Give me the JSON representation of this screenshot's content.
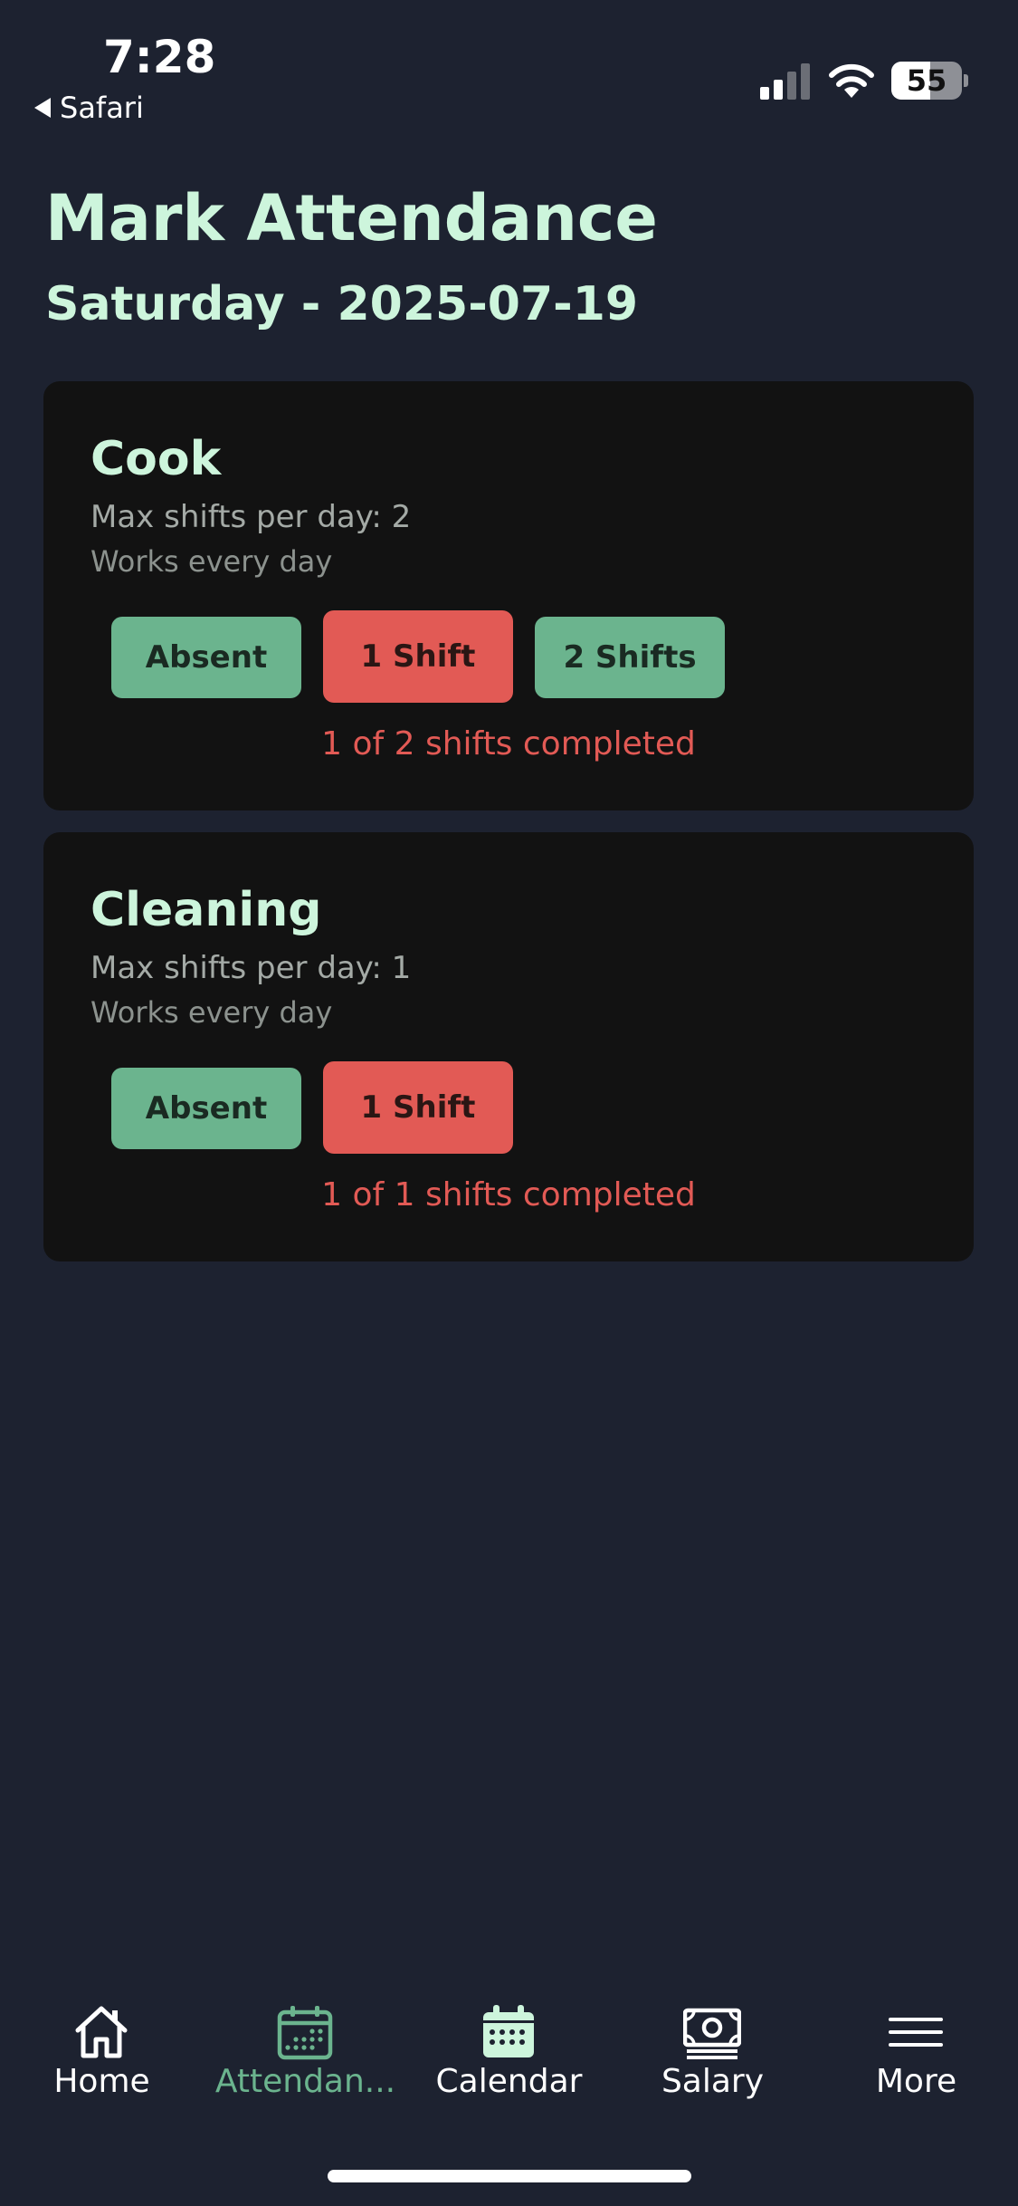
{
  "status_bar": {
    "time": "7:28",
    "back_label": "Safari",
    "battery_level": "55",
    "battery_fraction": 0.55
  },
  "header": {
    "title": "Mark Attendance",
    "date": "Saturday - 2025-07-19"
  },
  "employees": [
    {
      "name": "Cook",
      "max_shifts": "Max shifts per day: 2",
      "schedule": "Works every day",
      "buttons": [
        "Absent",
        "1 Shift",
        "2 Shifts"
      ],
      "selected": "1 Shift",
      "progress": "1 of 2 shifts completed"
    },
    {
      "name": "Cleaning",
      "max_shifts": "Max shifts per day: 1",
      "schedule": "Works every day",
      "buttons": [
        "Absent",
        "1 Shift"
      ],
      "selected": "1 Shift",
      "progress": "1 of 1 shifts completed"
    }
  ],
  "tab_bar": {
    "items": [
      {
        "label": "Home",
        "icon": "home-icon"
      },
      {
        "label": "Attendan...",
        "icon": "attendance-calendar-icon",
        "active": true
      },
      {
        "label": "Calendar",
        "icon": "calendar-icon"
      },
      {
        "label": "Salary",
        "icon": "cash-icon"
      },
      {
        "label": "More",
        "icon": "menu-icon"
      }
    ]
  },
  "colors": {
    "background": "#1d2230",
    "card": "#121212",
    "accent_green": "#6bb48e",
    "accent_red": "#e25a55",
    "heading": "#cdf5dc"
  }
}
